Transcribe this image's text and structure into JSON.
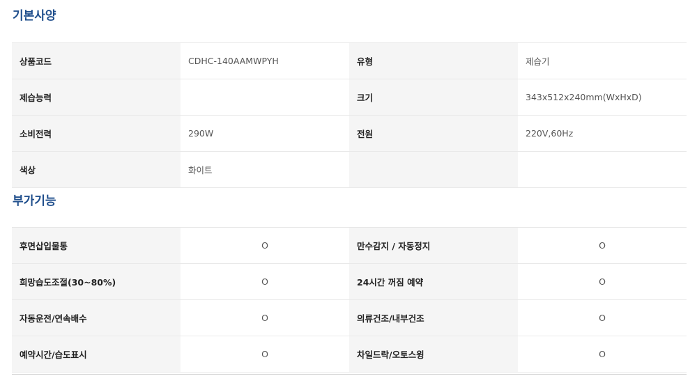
{
  "basic_spec": {
    "title": "기본사양",
    "rows": [
      [
        {
          "label": "상품코드",
          "value": "CDHC-140AAMWPYH"
        },
        {
          "label": "유형",
          "value": "제습기"
        }
      ],
      [
        {
          "label": "제습능력",
          "value": ""
        },
        {
          "label": "크기",
          "value": "343x512x240mm(WxHxD)"
        }
      ],
      [
        {
          "label": "소비전력",
          "value": "290W"
        },
        {
          "label": "전원",
          "value": "220V,60Hz"
        }
      ],
      [
        {
          "label": "색상",
          "value": "화이트"
        },
        {
          "label": "",
          "value": ""
        }
      ]
    ]
  },
  "extra_features": {
    "title": "부가기능",
    "rows": [
      [
        {
          "label": "후면삽입물통",
          "value": "O"
        },
        {
          "label": "만수감지 / 자동정지",
          "value": "O"
        }
      ],
      [
        {
          "label": "희망습도조절(30~80%)",
          "value": "O"
        },
        {
          "label": "24시간 꺼짐 예약",
          "value": "O"
        }
      ],
      [
        {
          "label": "자동운전/연속배수",
          "value": "O"
        },
        {
          "label": "의류건조/내부건조",
          "value": "O"
        }
      ],
      [
        {
          "label": "예약시간/습도표시",
          "value": "O"
        },
        {
          "label": "차일드락/오토스윙",
          "value": "O"
        }
      ]
    ]
  }
}
